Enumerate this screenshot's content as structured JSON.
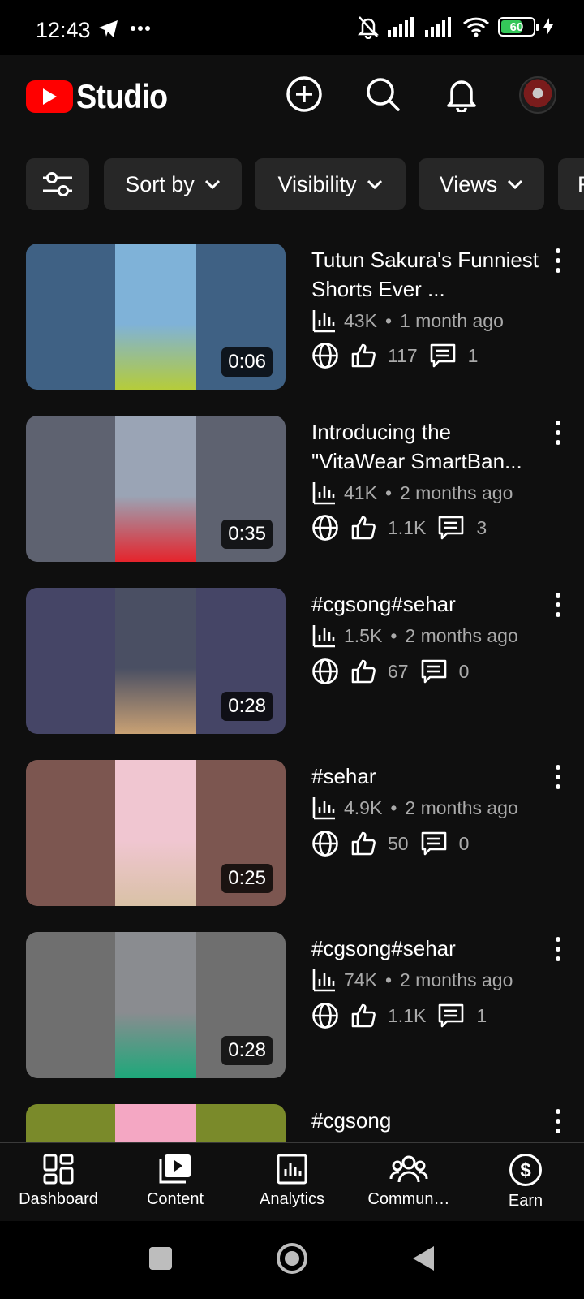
{
  "status_bar": {
    "time": "12:43",
    "battery": "60"
  },
  "app": {
    "logo_text": "Studio"
  },
  "filters": {
    "sort_label": "Sort by",
    "visibility_label": "Visibility",
    "views_label": "Views",
    "next_label": "F"
  },
  "videos": [
    {
      "title": "Tutun Sakura's Funniest Shorts Ever ...",
      "views": "43K",
      "age": "1 month ago",
      "likes": "117",
      "comments": "1",
      "duration": "0:06",
      "colors": {
        "bg": "#3f6184",
        "center": "#7fb2d8",
        "accent": "#b5cc3a"
      }
    },
    {
      "title": "Introducing the \"VitaWear SmartBan...",
      "views": "41K",
      "age": "2 months ago",
      "likes": "1.1K",
      "comments": "3",
      "duration": "0:35",
      "colors": {
        "bg": "#5e6270",
        "center": "#9aa4b5",
        "accent": "#e5242c"
      }
    },
    {
      "title": "#cgsong#sehar",
      "views": "1.5K",
      "age": "2 months ago",
      "likes": "67",
      "comments": "0",
      "duration": "0:28",
      "colors": {
        "bg": "#454566",
        "center": "#4a4f63",
        "accent": "#c9a174"
      }
    },
    {
      "title": "#sehar",
      "views": "4.9K",
      "age": "2 months ago",
      "likes": "50",
      "comments": "0",
      "duration": "0:25",
      "colors": {
        "bg": "#7c5650",
        "center": "#f0c6d1",
        "accent": "#d9c1a6"
      }
    },
    {
      "title": "#cgsong#sehar",
      "views": "74K",
      "age": "2 months ago",
      "likes": "1.1K",
      "comments": "1",
      "duration": "0:28",
      "colors": {
        "bg": "#6f6f6f",
        "center": "#8a8c90",
        "accent": "#1ea87a"
      }
    },
    {
      "title": "#cgsong",
      "views": "",
      "age": "",
      "likes": "",
      "comments": "",
      "duration": "",
      "colors": {
        "bg": "#7a8a2a",
        "center": "#f4a7c3",
        "accent": "#8dd33a"
      }
    }
  ],
  "nav": {
    "dashboard": "Dashboard",
    "content": "Content",
    "analytics": "Analytics",
    "community": "Commun…",
    "earn": "Earn"
  }
}
